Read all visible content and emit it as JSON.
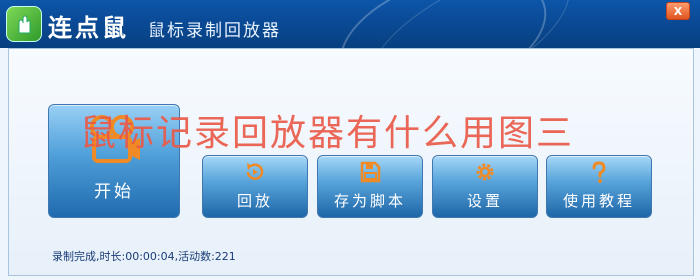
{
  "window": {
    "app_name": "连点鼠",
    "subtitle": "鼠标录制回放器",
    "close_label": "X"
  },
  "buttons": {
    "start": {
      "label": "开始",
      "icon": "record-icon"
    },
    "replay": {
      "label": "回放",
      "icon": "replay-icon"
    },
    "save_script": {
      "label": "存为脚本",
      "icon": "save-icon"
    },
    "settings": {
      "label": "设置",
      "icon": "gear-icon"
    },
    "tutorial": {
      "label": "使用教程",
      "icon": "help-icon"
    }
  },
  "watermark": "鼠标记录回放器有什么用图三",
  "status": "录制完成,时长:00:00:04,活动数:221",
  "colors": {
    "titlebar": "#0a4a96",
    "button_gradient_top": "#a6d7f7",
    "button_gradient_bottom": "#1e66a8",
    "icon_accent": "#f08a24",
    "watermark": "#ea5a48",
    "status_text": "#1a3d78"
  }
}
